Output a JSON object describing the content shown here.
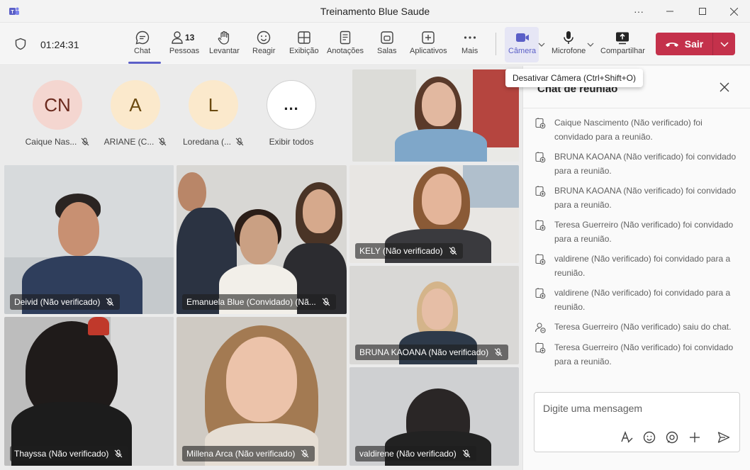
{
  "window": {
    "title": "Treinamento Blue Saude"
  },
  "toolbar": {
    "timer": "01:24:31",
    "chat": "Chat",
    "people": "Pessoas",
    "people_count": "13",
    "raise": "Levantar",
    "react": "Reagir",
    "view": "Exibição",
    "notes": "Anotações",
    "rooms": "Salas",
    "apps": "Aplicativos",
    "more": "Mais",
    "camera": "Câmera",
    "mic": "Microfone",
    "share": "Compartilhar",
    "leave": "Sair"
  },
  "tooltip": "Desativar Câmera (Ctrl+Shift+O)",
  "avatars": [
    {
      "initials": "CN",
      "name": "Caique Nas...",
      "color": "#f4d6d0",
      "text_color": "#6b2a1e"
    },
    {
      "initials": "A",
      "name": "ARIANE (C...",
      "color": "#fbe9cc",
      "text_color": "#6b4a10"
    },
    {
      "initials": "L",
      "name": "Loredana (...",
      "color": "#fbe9cc",
      "text_color": "#6b4a10"
    },
    {
      "initials": "...",
      "name": "Exibir todos",
      "color": "#ffffff",
      "text_color": "#242424"
    }
  ],
  "tiles": [
    {
      "name": "Deivid (Não verificado)"
    },
    {
      "name": "Emanuela Blue (Convidado) (Nã..."
    },
    {
      "name": "KELY (Não verificado)"
    },
    {
      "name": "BRUNA KAOANA (Não verificado)"
    },
    {
      "name": "Thayssa (Não verificado)"
    },
    {
      "name": "Millena Arca (Não verificado)"
    },
    {
      "name": "valdirene (Não verificado)"
    }
  ],
  "chat": {
    "title": "Chat de reunião",
    "placeholder": "Digite uma mensagem",
    "messages": [
      {
        "text": "Caique Nascimento (Não verificado) foi convidado para a reunião.",
        "icon": "person-added-icon"
      },
      {
        "text": "BRUNA KAOANA (Não verificado) foi convidado para a reunião.",
        "icon": "person-added-icon"
      },
      {
        "text": "BRUNA KAOANA (Não verificado) foi convidado para a reunião.",
        "icon": "person-added-icon"
      },
      {
        "text": "Teresa Guerreiro (Não verificado) foi convidado para a reunião.",
        "icon": "person-added-icon"
      },
      {
        "text": "valdirene (Não verificado) foi convidado para a reunião.",
        "icon": "person-added-icon"
      },
      {
        "text": "valdirene (Não verificado) foi convidado para a reunião.",
        "icon": "person-added-icon"
      },
      {
        "text": "Teresa Guerreiro (Não verificado) saiu do chat.",
        "icon": "person-left-icon"
      },
      {
        "text": "Teresa Guerreiro (Não verificado) foi convidado para a reunião.",
        "icon": "person-added-icon"
      }
    ]
  },
  "colors": {
    "accent": "#5b5fc7",
    "leave": "#c4314b"
  }
}
